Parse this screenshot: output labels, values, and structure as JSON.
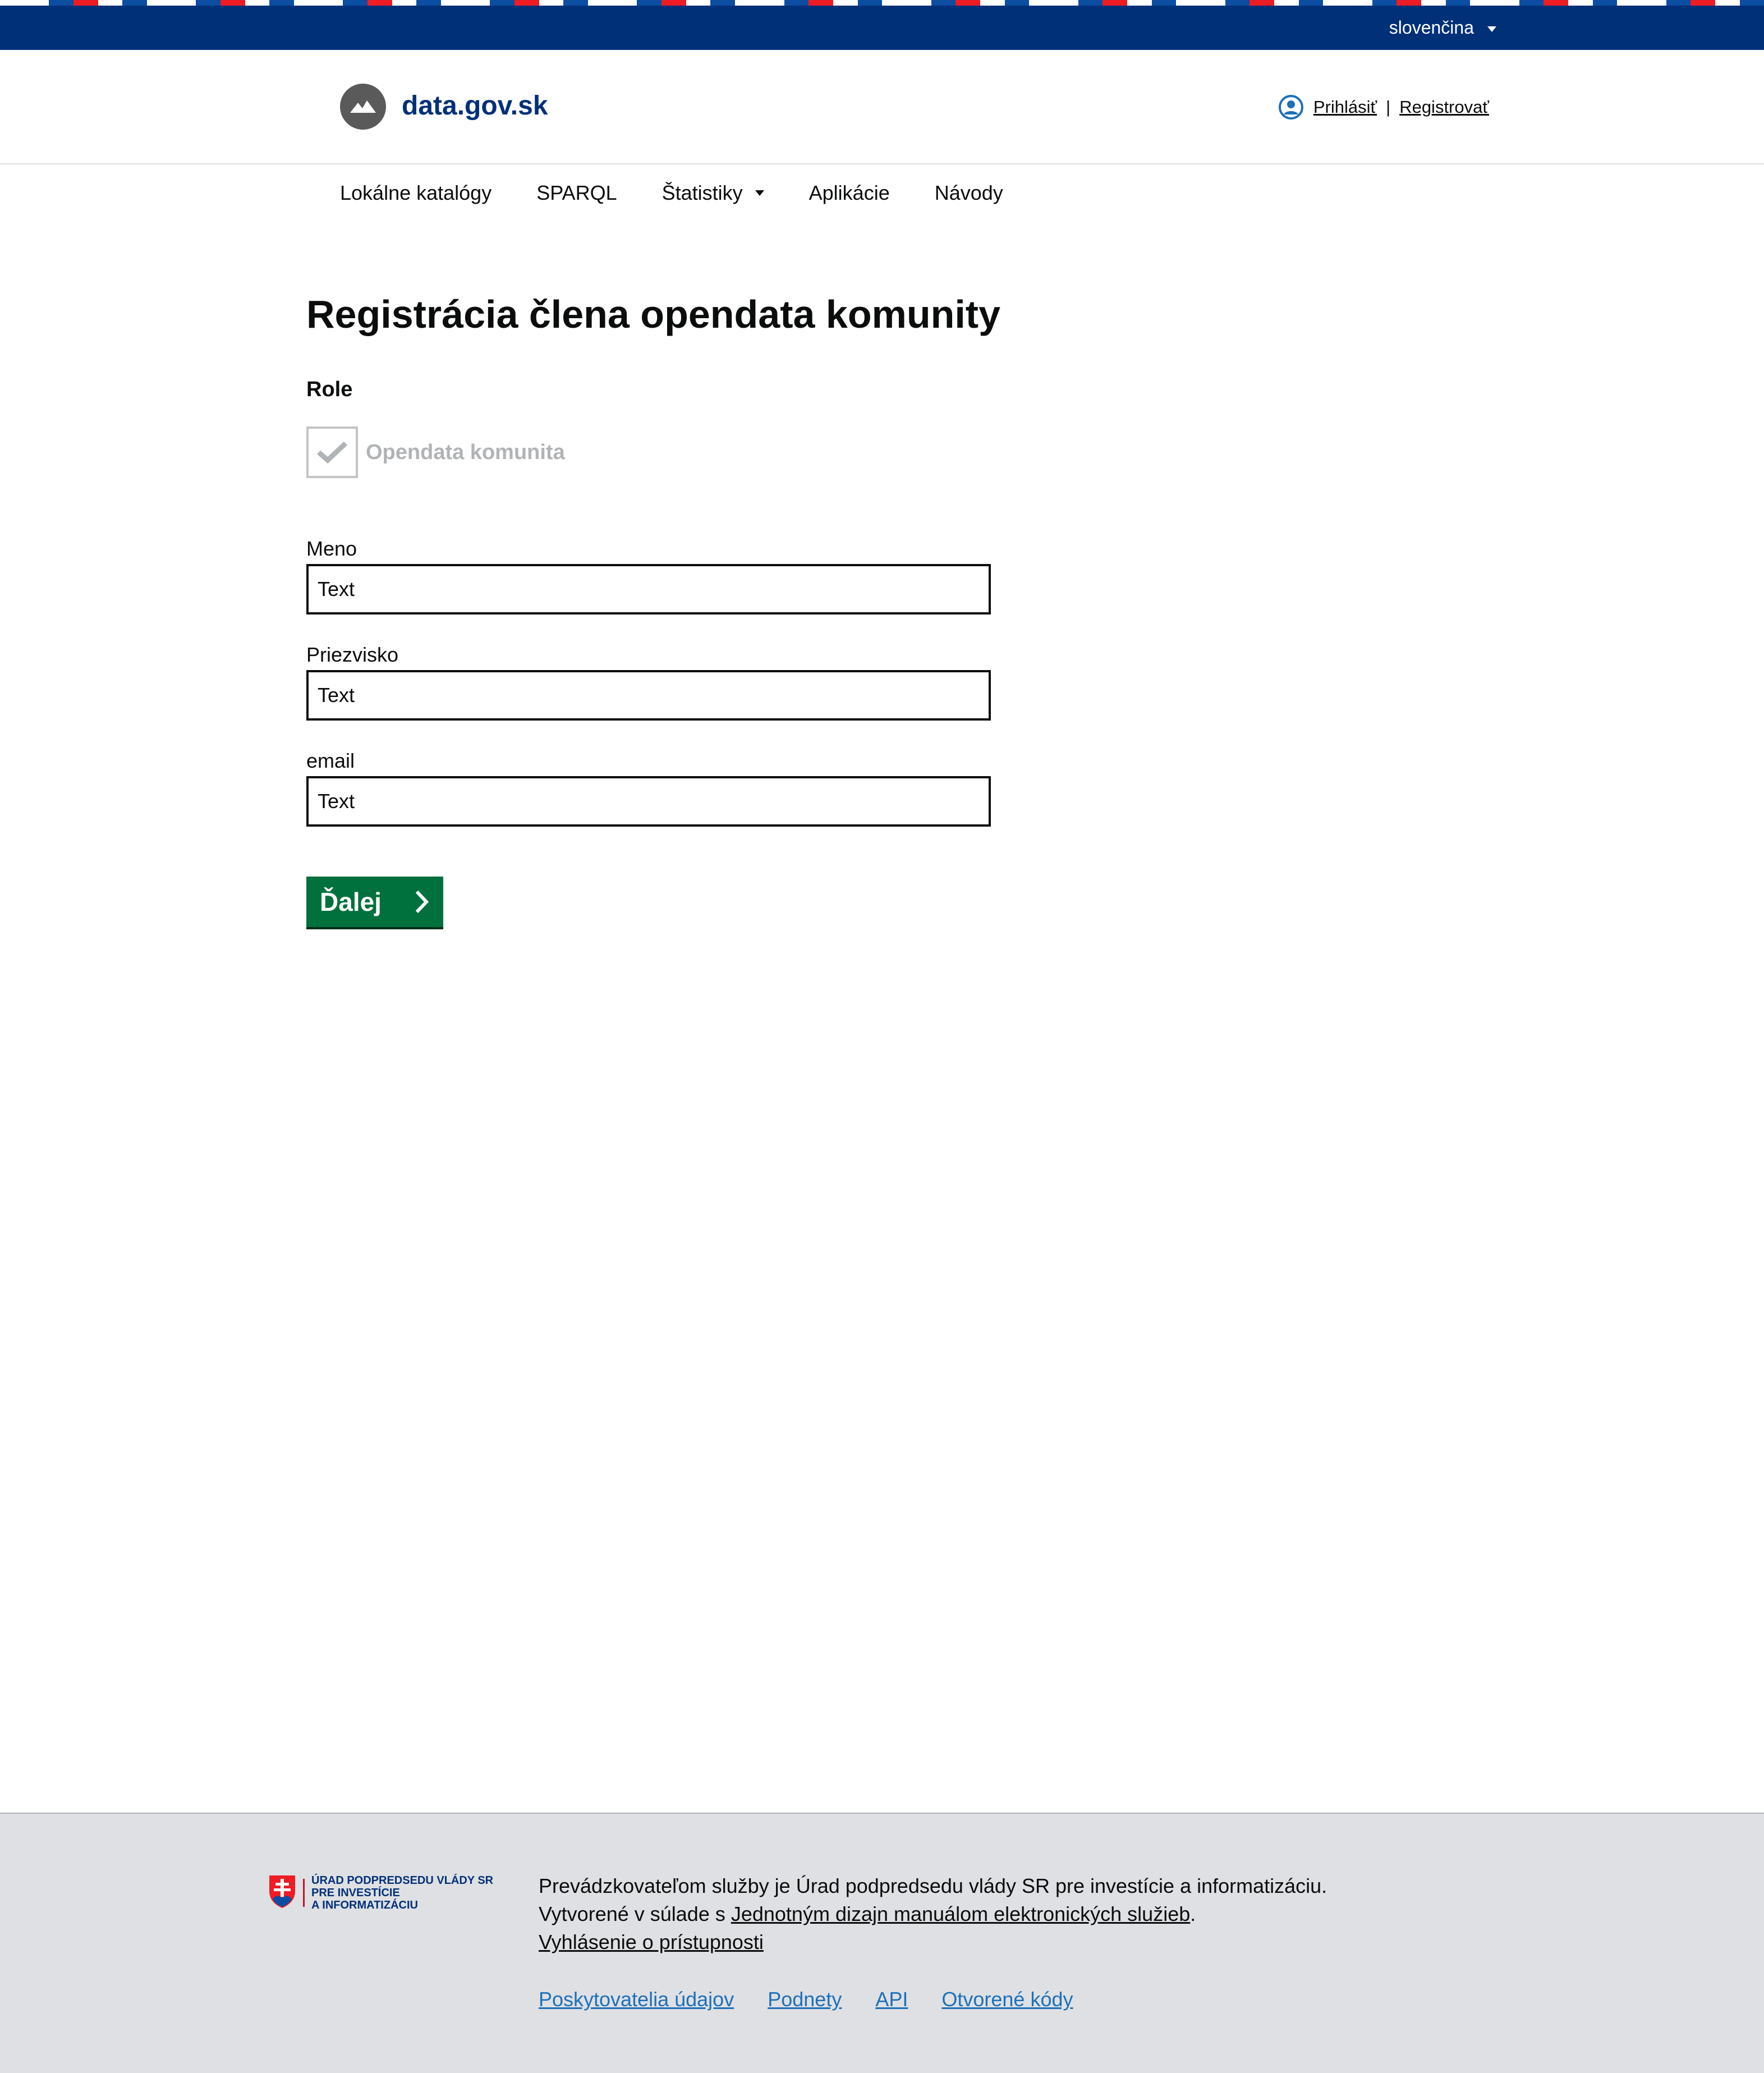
{
  "colors": {
    "top_bar": "#003078",
    "flag_blue": "#0b4ea2",
    "flag_red": "#ee1c25",
    "flag_white": "#ffffff",
    "primary_button": "#00703c",
    "link": "#1d70b8",
    "footer_bg": "#dfe0e3"
  },
  "topbar": {
    "language": "slovenčina"
  },
  "header": {
    "site_name": "data.gov.sk",
    "login": "Prihlásiť",
    "separator": "|",
    "register": "Registrovať"
  },
  "nav": {
    "items": [
      {
        "label": "Lokálne katalógy"
      },
      {
        "label": "SPARQL"
      },
      {
        "label": "Štatistiky"
      },
      {
        "label": "Aplikácie"
      },
      {
        "label": "Návody"
      }
    ]
  },
  "main": {
    "title": "Registrácia člena opendata komunity",
    "role_label": "Role",
    "role_option": "Opendata komunita",
    "role_checked": true,
    "fields": [
      {
        "label": "Meno",
        "value": "Text"
      },
      {
        "label": "Priezvisko",
        "value": "Text"
      },
      {
        "label": "email",
        "value": "Text"
      }
    ],
    "next_label": "Ďalej"
  },
  "footer": {
    "emblem_lines": [
      "ÚRAD PODPREDSEDU VLÁDY SR",
      "PRE INVESTÍCIE",
      "A INFORMATIZÁCIU"
    ],
    "operator_text": "Prevádzkovateľom služby je Úrad podpredsedu vlády SR pre investície a informatizáciu.",
    "created_prefix": "Vytvorené v súlade s ",
    "created_link": "Jednotným dizajn manuálom elektronických služieb",
    "created_suffix": ".",
    "accessibility": "Vyhlásenie o prístupnosti",
    "links": [
      "Poskytovatelia údajov",
      "Podnety",
      "API",
      "Otvorené kódy"
    ]
  }
}
